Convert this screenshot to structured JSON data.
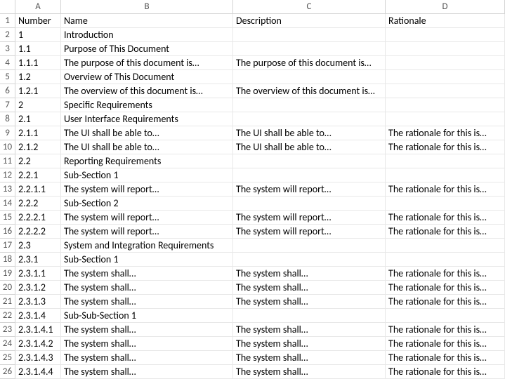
{
  "columns": [
    "A",
    "B",
    "C",
    "D"
  ],
  "headerRow": [
    "Number",
    "Name",
    "Description",
    "Rationale"
  ],
  "rows": [
    [
      "1",
      "Introduction",
      "",
      ""
    ],
    [
      "1.1",
      "Purpose of This Document",
      "",
      ""
    ],
    [
      "1.1.1",
      "The purpose of this document is…",
      "The purpose of this document is…",
      ""
    ],
    [
      "1.2",
      "Overview of This Document",
      "",
      ""
    ],
    [
      "1.2.1",
      "The overview of this document is…",
      "The overview of this document is…",
      ""
    ],
    [
      "2",
      "Specific Requirements",
      "",
      ""
    ],
    [
      "2.1",
      "User Interface Requirements",
      "",
      ""
    ],
    [
      "2.1.1",
      "The UI shall be able to…",
      "The UI shall be able to…",
      "The rationale for this is…"
    ],
    [
      "2.1.2",
      "The UI shall be able to…",
      "The UI shall be able to…",
      "The rationale for this is…"
    ],
    [
      "2.2",
      "Reporting Requirements",
      "",
      ""
    ],
    [
      "2.2.1",
      "Sub-Section 1",
      "",
      ""
    ],
    [
      "2.2.1.1",
      "The system will report…",
      "The system will report…",
      "The rationale for this is…"
    ],
    [
      "2.2.2",
      "Sub-Section 2",
      "",
      ""
    ],
    [
      "2.2.2.1",
      "The system will report…",
      "The system will report…",
      "The rationale for this is…"
    ],
    [
      "2.2.2.2",
      "The system will report…",
      "The system will report…",
      "The rationale for this is…"
    ],
    [
      "2.3",
      "System and Integration Requirements",
      "",
      ""
    ],
    [
      "2.3.1",
      "Sub-Section 1",
      "",
      ""
    ],
    [
      "2.3.1.1",
      "The system shall…",
      "The system shall…",
      "The rationale for this is…"
    ],
    [
      "2.3.1.2",
      "The system shall…",
      "The system shall…",
      "The rationale for this is…"
    ],
    [
      "2.3.1.3",
      "The system shall…",
      "The system shall…",
      "The rationale for this is…"
    ],
    [
      "2.3.1.4",
      "Sub-Sub-Section 1",
      "",
      ""
    ],
    [
      "2.3.1.4.1",
      "The system shall…",
      "The system shall…",
      "The rationale for this is…"
    ],
    [
      "2.3.1.4.2",
      "The system shall…",
      "The system shall…",
      "The rationale for this is…"
    ],
    [
      "2.3.1.4.3",
      "The system shall…",
      "The system shall…",
      "The rationale for this is…"
    ],
    [
      "2.3.1.4.4",
      "The system shall…",
      "The system shall…",
      "The rationale for this is…"
    ]
  ]
}
